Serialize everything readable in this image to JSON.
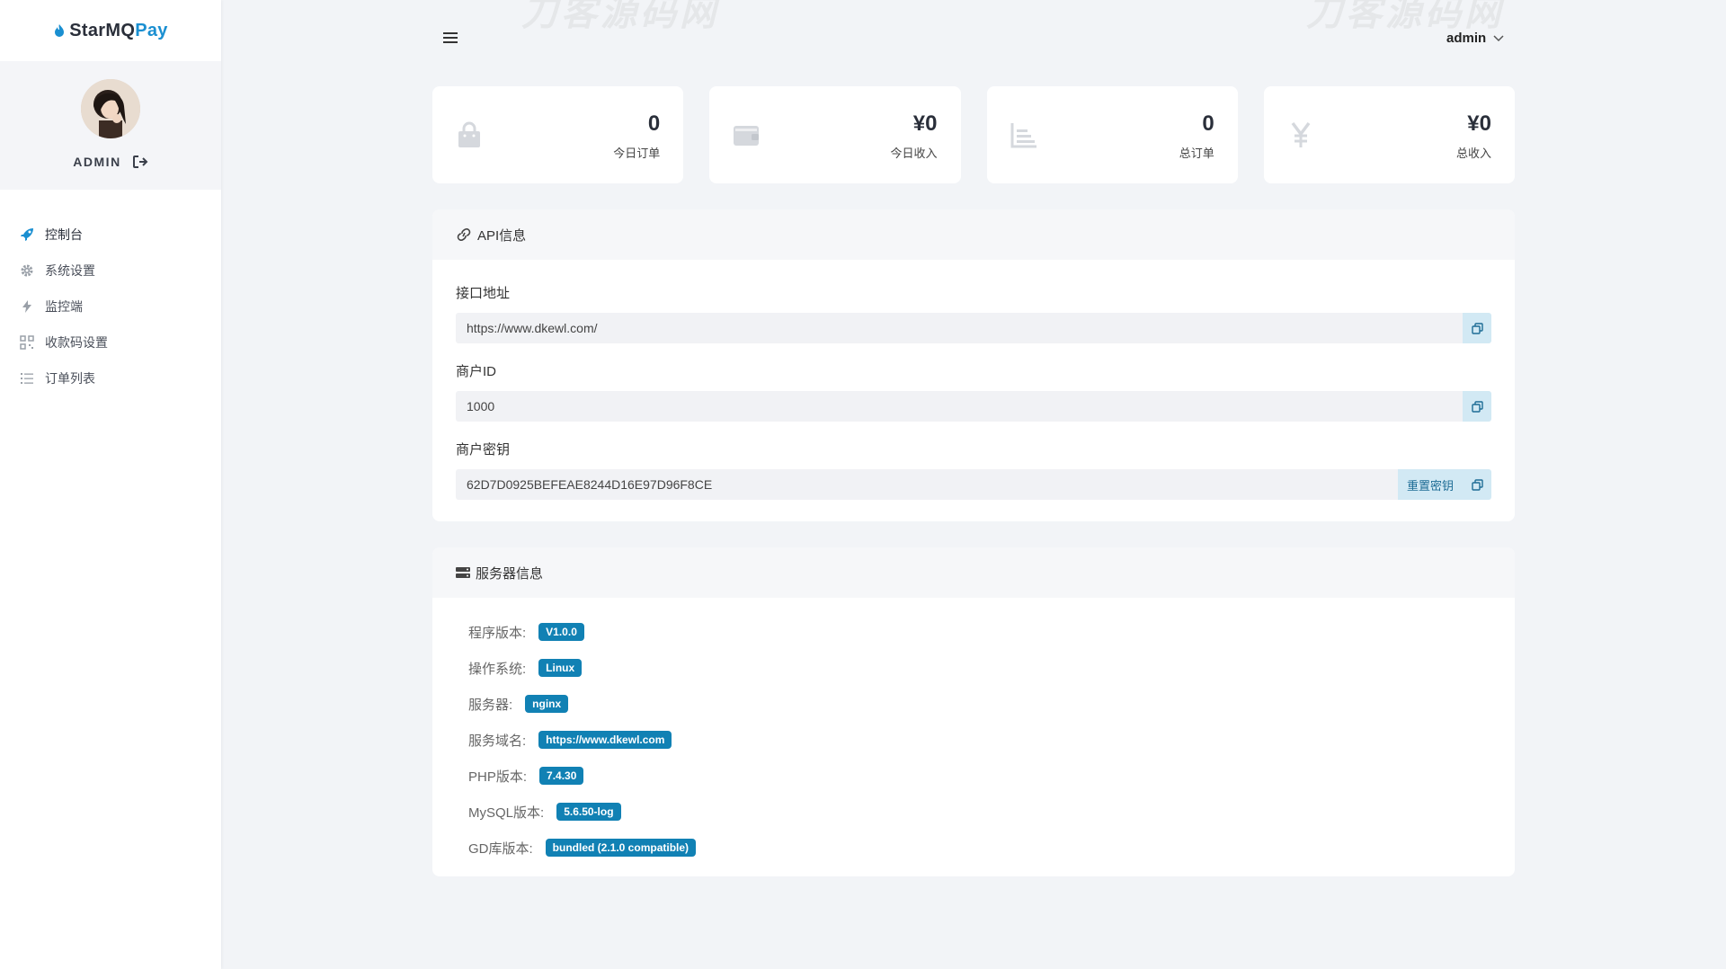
{
  "brand": {
    "part1": "StarMQ",
    "part2": "Pay"
  },
  "profile": {
    "name": "ADMIN"
  },
  "menu": [
    {
      "label": "控制台",
      "icon": "rocket-icon",
      "active": true
    },
    {
      "label": "系统设置",
      "icon": "gear-icon"
    },
    {
      "label": "监控端",
      "icon": "lightning-icon"
    },
    {
      "label": "收款码设置",
      "icon": "qr-grid-icon"
    },
    {
      "label": "订单列表",
      "icon": "list-icon"
    }
  ],
  "header": {
    "username": "admin"
  },
  "watermark": {
    "text": "刀客源码网"
  },
  "stats": [
    {
      "value": "0",
      "label": "今日订单",
      "icon": "shopping-bag-icon"
    },
    {
      "value": "¥0",
      "label": "今日收入",
      "icon": "wallet-icon"
    },
    {
      "value": "0",
      "label": "总订单",
      "icon": "bar-chart-icon"
    },
    {
      "value": "¥0",
      "label": "总收入",
      "icon": "yen-icon"
    }
  ],
  "api_panel": {
    "title": "API信息",
    "fields": [
      {
        "label": "接口地址",
        "value": "https://www.dkewl.com/"
      },
      {
        "label": "商户ID",
        "value": "1000"
      },
      {
        "label": "商户密钥",
        "value": "62D7D0925BEFEAE8244D16E97D96F8CE",
        "reset_label": "重置密钥"
      }
    ]
  },
  "server_panel": {
    "title": "服务器信息",
    "rows": [
      {
        "key": "程序版本:",
        "value": "V1.0.0"
      },
      {
        "key": "操作系统:",
        "value": "Linux"
      },
      {
        "key": "服务器:",
        "value": "nginx"
      },
      {
        "key": "服务域名:",
        "value": "https://www.dkewl.com"
      },
      {
        "key": "PHP版本:",
        "value": "7.4.30"
      },
      {
        "key": "MySQL版本:",
        "value": "5.6.50-log"
      },
      {
        "key": "GD库版本:",
        "value": "bundled (2.1.0 compatible)"
      }
    ]
  },
  "colors": {
    "accent": "#1181b4",
    "brand_blue": "#1a8fd1",
    "copy_btn_bg": "#d2e9f4",
    "page_bg": "#f2f4f7"
  }
}
